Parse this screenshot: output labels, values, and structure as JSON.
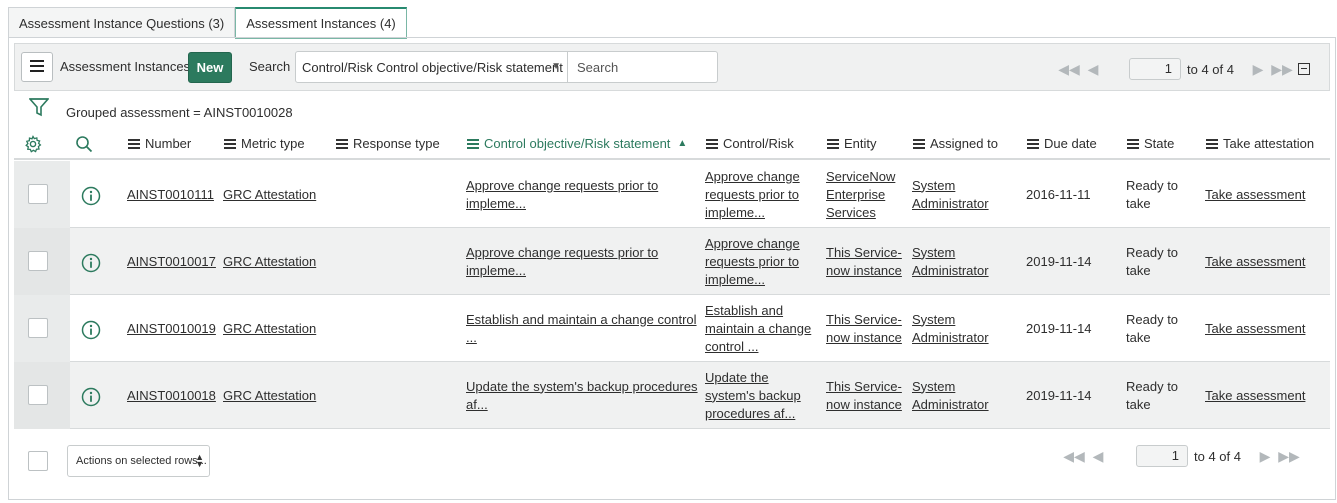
{
  "tabs": [
    {
      "label": "Assessment Instance Questions (3)",
      "active": false
    },
    {
      "label": "Assessment Instances (4)",
      "active": true
    }
  ],
  "toolbar": {
    "title": "Assessment Instances",
    "new_label": "New",
    "search_label": "Search",
    "search_field": "Control/Risk Control objective/Risk statement",
    "search_placeholder": "Search",
    "page_value": "1",
    "page_text": "to 4 of 4"
  },
  "filter": {
    "text": "Grouped assessment = AINST0010028"
  },
  "columns": [
    {
      "label": "Number"
    },
    {
      "label": "Metric type"
    },
    {
      "label": "Response type"
    },
    {
      "label": "Control objective/Risk statement",
      "sorted": "ascending"
    },
    {
      "label": "Control/Risk"
    },
    {
      "label": "Entity"
    },
    {
      "label": "Assigned to"
    },
    {
      "label": "Due date"
    },
    {
      "label": "State"
    },
    {
      "label": "Take attestation"
    }
  ],
  "rows": [
    {
      "number": "AINST0010111",
      "metric_type": "GRC Attestation",
      "response_type": "",
      "objective": [
        "Approve change requests prior to",
        "impleme..."
      ],
      "control": [
        "Approve change",
        "requests prior to",
        "impleme..."
      ],
      "entity": [
        "ServiceNow",
        "Enterprise",
        "Services"
      ],
      "assigned": [
        "System",
        "Administrator"
      ],
      "due": "2016-11-11",
      "state": [
        "Ready to",
        "take"
      ],
      "take": "Take assessment"
    },
    {
      "number": "AINST0010017",
      "metric_type": "GRC Attestation",
      "response_type": "",
      "objective": [
        "Approve change requests prior to",
        "impleme..."
      ],
      "control": [
        "Approve change",
        "requests prior to",
        "impleme..."
      ],
      "entity": [
        "This Service-",
        "now instance"
      ],
      "assigned": [
        "System",
        "Administrator"
      ],
      "due": "2019-11-14",
      "state": [
        "Ready to",
        "take"
      ],
      "take": "Take assessment"
    },
    {
      "number": "AINST0010019",
      "metric_type": "GRC Attestation",
      "response_type": "",
      "objective": [
        "Establish and maintain a change control",
        "..."
      ],
      "control": [
        "Establish and",
        "maintain a change",
        "control ..."
      ],
      "entity": [
        "This Service-",
        "now instance"
      ],
      "assigned": [
        "System",
        "Administrator"
      ],
      "due": "2019-11-14",
      "state": [
        "Ready to",
        "take"
      ],
      "take": "Take assessment"
    },
    {
      "number": "AINST0010018",
      "metric_type": "GRC Attestation",
      "response_type": "",
      "objective": [
        "Update the system's backup procedures",
        "af..."
      ],
      "control": [
        "Update the",
        "system's backup",
        "procedures af..."
      ],
      "entity": [
        "This Service-",
        "now instance"
      ],
      "assigned": [
        "System",
        "Administrator"
      ],
      "due": "2019-11-14",
      "state": [
        "Ready to",
        "take"
      ],
      "take": "Take assessment"
    }
  ],
  "footer": {
    "actions_label": "Actions on selected rows...",
    "page_value": "1",
    "page_text": "to 4 of 4"
  },
  "colors": {
    "accent": "#2c7a5e",
    "row_alt": "#f0f1f1",
    "border": "#d7dadb"
  },
  "icons": [
    "menu-icon",
    "filter-icon",
    "gear-icon",
    "search-icon",
    "info-icon",
    "first-page-icon",
    "prev-page-icon",
    "next-page-icon",
    "last-page-icon",
    "collapse-icon"
  ]
}
